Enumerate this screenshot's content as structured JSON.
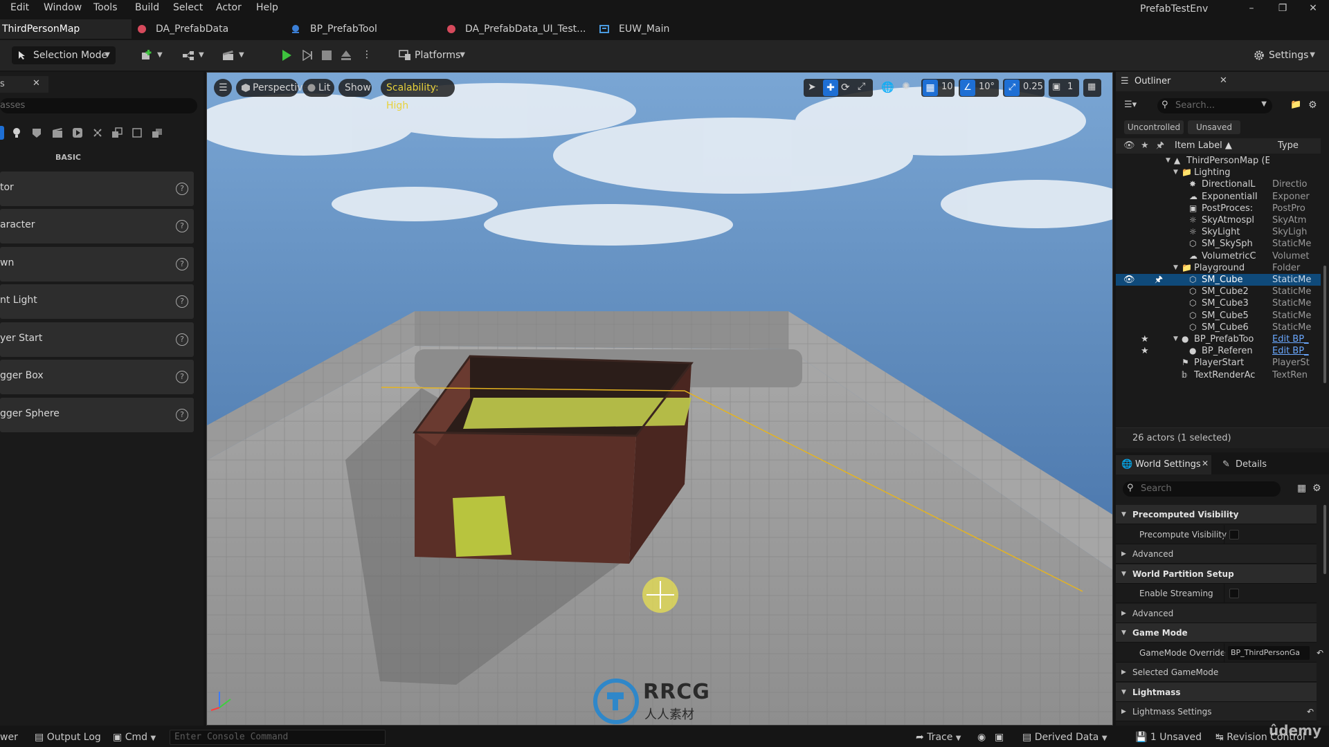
{
  "menu": {
    "items": [
      "Edit",
      "Window",
      "Tools",
      "Build",
      "Select",
      "Actor",
      "Help"
    ],
    "project_name": "PrefabTestEnv"
  },
  "tabs": [
    {
      "label": "ThirdPersonMap",
      "icon": "level-icon"
    },
    {
      "label": "DA_PrefabData",
      "icon": "data-asset-icon"
    },
    {
      "label": "BP_PrefabTool",
      "icon": "blueprint-icon"
    },
    {
      "label": "DA_PrefabData_UI_Test...",
      "icon": "data-asset-icon"
    },
    {
      "label": "EUW_Main",
      "icon": "widget-icon"
    }
  ],
  "toolbar": {
    "selection_mode": "Selection Mode",
    "platforms": "Platforms",
    "settings": "Settings"
  },
  "left_panel": {
    "tab_label": "s",
    "search_placeholder": "asses",
    "section": "BASIC",
    "items": [
      "tor",
      "aracter",
      "wn",
      "nt Light",
      "yer Start",
      "gger Box",
      "gger Sphere"
    ]
  },
  "viewport": {
    "perspective": "Perspective",
    "lit": "Lit",
    "show": "Show",
    "scalability": "Scalability: High",
    "grid_snap": "10",
    "rot_snap": "10°",
    "scale_snap": "0.25",
    "camera_speed": "1",
    "watermark": "RRCG",
    "watermark_sub": "人人素材"
  },
  "outliner": {
    "title": "Outliner",
    "search_placeholder": "Search...",
    "filters": [
      "Uncontrolled",
      "Unsaved"
    ],
    "col_label": "Item Label",
    "col_type": "Type",
    "rows": [
      {
        "name": "ThirdPersonMap (Editor)",
        "type": "",
        "indent": 0,
        "icon": "map-icon"
      },
      {
        "name": "Lighting",
        "type": "",
        "indent": 1,
        "icon": "folder-icon"
      },
      {
        "name": "DirectionalL",
        "type": "Directio",
        "indent": 2,
        "icon": "directional-light-icon"
      },
      {
        "name": "ExponentialI",
        "type": "Exponer",
        "indent": 2,
        "icon": "fog-icon"
      },
      {
        "name": "PostProces:",
        "type": "PostPro",
        "indent": 2,
        "icon": "postprocess-icon"
      },
      {
        "name": "SkyAtmospl",
        "type": "SkyAtm",
        "indent": 2,
        "icon": "sky-atmosphere-icon"
      },
      {
        "name": "SkyLight",
        "type": "SkyLigh",
        "indent": 2,
        "icon": "skylight-icon"
      },
      {
        "name": "SM_SkySph",
        "type": "StaticMe",
        "indent": 2,
        "icon": "static-mesh-icon"
      },
      {
        "name": "VolumetricC",
        "type": "Volumet",
        "indent": 2,
        "icon": "cloud-icon"
      },
      {
        "name": "Playground",
        "type": "Folder",
        "indent": 1,
        "icon": "folder-icon"
      },
      {
        "name": "SM_Cube",
        "type": "StaticMe",
        "indent": 2,
        "icon": "static-mesh-icon",
        "selected": true
      },
      {
        "name": "SM_Cube2",
        "type": "StaticMe",
        "indent": 2,
        "icon": "static-mesh-icon"
      },
      {
        "name": "SM_Cube3",
        "type": "StaticMe",
        "indent": 2,
        "icon": "static-mesh-icon"
      },
      {
        "name": "SM_Cube5",
        "type": "StaticMe",
        "indent": 2,
        "icon": "static-mesh-icon"
      },
      {
        "name": "SM_Cube6",
        "type": "StaticMe",
        "indent": 2,
        "icon": "static-mesh-icon"
      },
      {
        "name": "BP_PrefabToo",
        "type": "Edit BP_",
        "indent": 1,
        "icon": "blueprint-actor-icon",
        "link": true
      },
      {
        "name": "BP_Referen",
        "type": "Edit BP_",
        "indent": 2,
        "icon": "blueprint-actor-icon",
        "link": true
      },
      {
        "name": "PlayerStart",
        "type": "PlayerSt",
        "indent": 1,
        "icon": "player-start-icon"
      },
      {
        "name": "TextRenderAc",
        "type": "TextRen",
        "indent": 1,
        "icon": "text-render-icon"
      }
    ],
    "summary": "26 actors (1 selected)"
  },
  "details": {
    "tab_world_settings": "World Settings",
    "tab_details": "Details",
    "search_placeholder": "Search",
    "rows": [
      {
        "kind": "cat",
        "label": "Precomputed Visibility"
      },
      {
        "kind": "prop",
        "label": "Precompute Visibility",
        "checkbox": true
      },
      {
        "kind": "sub",
        "label": "Advanced"
      },
      {
        "kind": "cat",
        "label": "World Partition Setup"
      },
      {
        "kind": "prop",
        "label": "Enable Streaming",
        "checkbox": true
      },
      {
        "kind": "sub",
        "label": "Advanced"
      },
      {
        "kind": "cat",
        "label": "Game Mode"
      },
      {
        "kind": "prop",
        "label": "GameMode Override",
        "value": "BP_ThirdPersonGa"
      },
      {
        "kind": "sub",
        "label": "Selected GameMode"
      },
      {
        "kind": "cat",
        "label": "Lightmass"
      },
      {
        "kind": "sub",
        "label": "Lightmass Settings"
      }
    ]
  },
  "statusbar": {
    "drawer": "wer",
    "output_log": "Output Log",
    "cmd": "Cmd",
    "console_placeholder": "Enter Console Command",
    "trace": "Trace",
    "derived_data": "Derived Data",
    "unsaved": "1 Unsaved",
    "revision_control": "Revision Control",
    "udemy": "ûdemy"
  },
  "colors": {
    "accent_blue": "#0f4a7a",
    "play_green": "#3ec23e",
    "scalability_yellow": "#e8d23a"
  }
}
